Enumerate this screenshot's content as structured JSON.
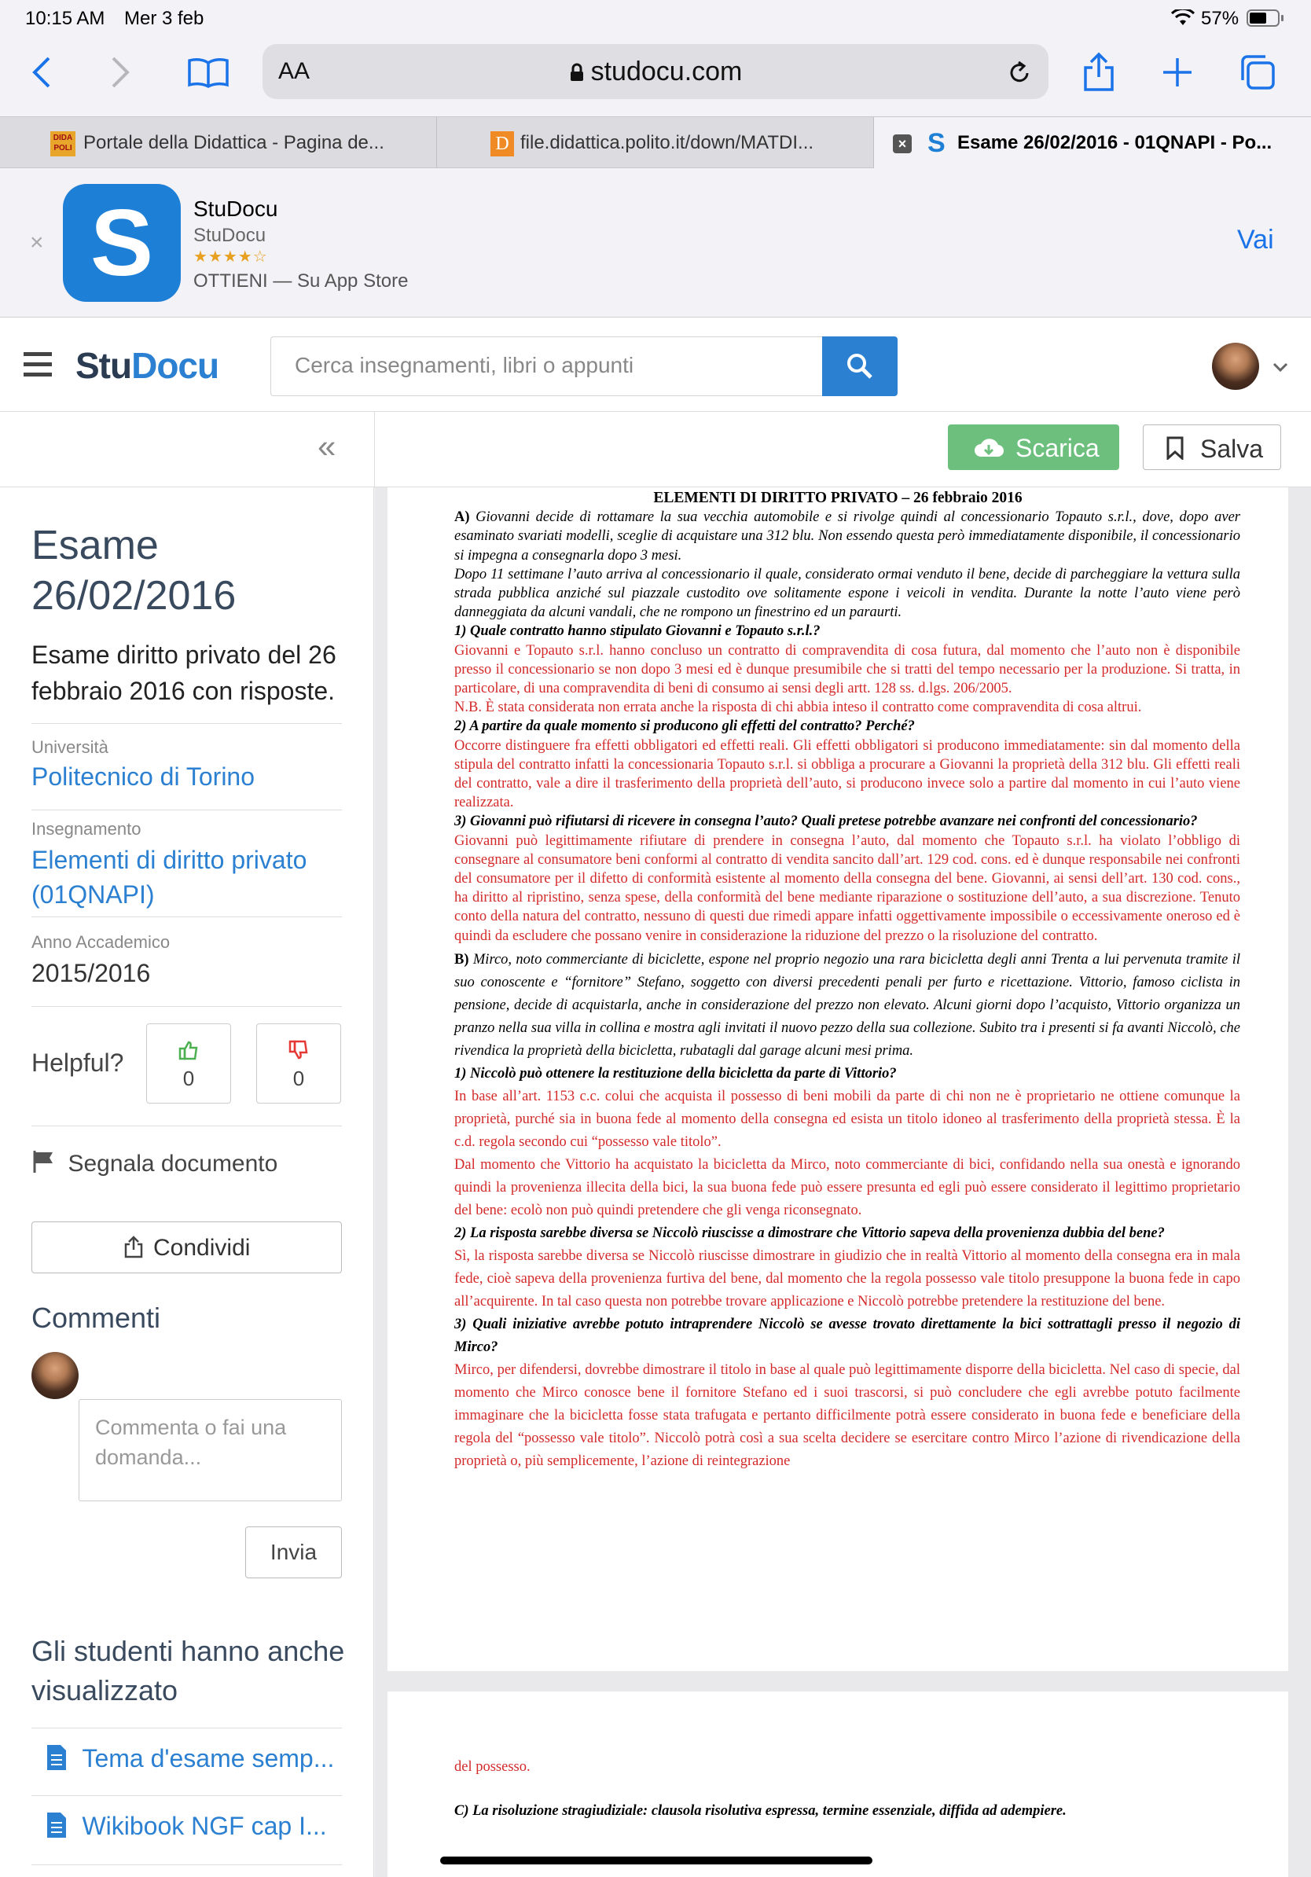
{
  "status_bar": {
    "time": "10:15 AM",
    "date": "Mer 3 feb",
    "battery": "57%"
  },
  "browser": {
    "aa_label": "AA",
    "url": "studocu.com",
    "tabs": [
      {
        "label": "Portale della Didattica - Pagina de..."
      },
      {
        "label": "file.didattica.polito.it/down/MATDI..."
      },
      {
        "label": "Esame 26/02/2016 - 01QNAPI - Po..."
      }
    ]
  },
  "app_banner": {
    "icon_letter": "S",
    "name": "StuDocu",
    "developer": "StuDocu",
    "stars": "★★★★☆",
    "cta": "OTTIENI — Su App Store",
    "open_label": "Vai"
  },
  "site": {
    "logo_stu": "Stu",
    "logo_docu": "Docu",
    "search_placeholder": "Cerca insegnamenti, libri o appunti",
    "download_label": "Scarica",
    "save_label": "Salva",
    "collapse_glyph": "«"
  },
  "sidebar": {
    "title_line1": "Esame",
    "title_line2": "26/02/2016",
    "description": "Esame diritto privato del 26 febbraio 2016 con risposte.",
    "university_label": "Università",
    "university": "Politecnico di Torino",
    "course_label": "Insegnamento",
    "course": "Elementi di diritto privato (01QNAPI)",
    "year_label": "Anno Accademico",
    "year": "2015/2016",
    "helpful_label": "Helpful?",
    "upvotes": "0",
    "downvotes": "0",
    "report_label": "Segnala documento",
    "share_label": "Condividi",
    "comments_title": "Commenti",
    "comment_placeholder": "Commenta o fai una domanda...",
    "send_label": "Invia",
    "related_title": "Gli studenti hanno anche visualizzato",
    "related": [
      {
        "label": "Tema d'esame semp..."
      },
      {
        "label": "Wikibook NGF cap I..."
      }
    ]
  },
  "document": {
    "title": "ELEMENTI DI DIRITTO PRIVATO – 26 febbraio 2016",
    "a_label": "A)",
    "a_text": "Giovanni decide di rottamare la sua vecchia automobile e si rivolge quindi al concessionario Topauto s.r.l., dove, dopo aver esaminato svariati modelli, sceglie di acquistare una 312 blu. Non essendo questa però immediatamente disponibile, il concessionario si impegna a consegnarla dopo 3 mesi.",
    "a_text2": "Dopo 11 settimane l’auto arriva al concessionario il quale, considerato ormai venduto il bene, decide di parcheggiare la vettura sulla strada pubblica anziché sul piazzale custodito ove solitamente espone i veicoli in vendita. Durante la notte l’auto viene però danneggiata da alcuni vandali, che ne rompono un finestrino ed un paraurti.",
    "q1": "1) Quale contratto hanno stipulato Giovanni e Topauto s.r.l.?",
    "a1": "Giovanni e Topauto s.r.l. hanno concluso un contratto di compravendita di cosa futura, dal momento che l’auto non è disponibile presso il concessionario se non dopo 3 mesi ed è dunque presumibile che si tratti del tempo necessario per la produzione. Si tratta, in particolare, di una compravendita di beni di consumo ai sensi degli artt. 128 ss. d.lgs. 206/2005.",
    "a1_nb": "N.B. È stata considerata non errata anche la risposta di chi abbia inteso il contratto come compravendita di cosa altrui.",
    "q2": "2) A partire da quale momento si producono gli effetti del contratto? Perché?",
    "a2": "Occorre distinguere fra effetti obbligatori ed effetti reali. Gli effetti obbligatori si producono immediatamente: sin dal momento della stipula del contratto infatti la concessionaria Topauto s.r.l. si obbliga a procurare a Giovanni la proprietà della 312 blu. Gli effetti reali del contratto, vale a dire il trasferimento della proprietà dell’auto, si producono invece solo a partire dal momento in cui l’auto viene realizzata.",
    "q3": "3) Giovanni può rifiutarsi di ricevere in consegna l’auto? Quali pretese potrebbe avanzare nei confronti del concessionario?",
    "a3": "Giovanni può legittimamente rifiutare di prendere in consegna l’auto, dal momento che Topauto s.r.l. ha violato l’obbligo di consegnare al consumatore beni conformi al contratto di vendita sancito dall’art. 129 cod. cons. ed è dunque responsabile nei confronti del consumatore per il difetto di conformità esistente al momento della consegna del bene. Giovanni, ai sensi dell’art. 130 cod. cons., ha diritto al ripristino, senza spese, della conformità del bene mediante riparazione o sostituzione dell’auto, a sua discrezione. Tenuto conto della natura del contratto, nessuno di questi due rimedi appare infatti oggettivamente impossibile o eccessivamente oneroso ed è quindi da escludere che possano venire in considerazione la riduzione del prezzo o la risoluzione del contratto.",
    "b_label": "B)",
    "b_text": "Mirco, noto commerciante di biciclette, espone nel proprio negozio una rara bicicletta degli anni Trenta a lui pervenuta tramite il suo conoscente e “fornitore” Stefano, soggetto con diversi precedenti penali per furto e ricettazione. Vittorio, famoso ciclista in pensione, decide di acquistarla, anche in considerazione del prezzo non elevato. Alcuni giorni dopo l’acquisto, Vittorio organizza un pranzo nella sua villa in collina e mostra agli invitati il nuovo pezzo della sua collezione. Subito tra i presenti si fa avanti Niccolò, che rivendica la proprietà della bicicletta, rubatagli dal garage alcuni mesi prima.",
    "bq1": "1) Niccolò può ottenere la restituzione della bicicletta da parte di Vittorio?",
    "ba1": "In base all’art. 1153 c.c. colui che acquista il possesso di beni mobili da parte di chi non ne è proprietario ne ottiene comunque la proprietà, purché sia in buona fede al momento della consegna ed esista un titolo idoneo al trasferimento della proprietà stessa. È la c.d. regola  secondo cui “possesso vale titolo”.",
    "ba1b": "Dal momento che Vittorio ha acquistato la bicicletta da Mirco, noto commerciante di bici, confidando nella sua onestà e ignorando quindi la provenienza illecita della bici, la sua buona fede può essere presunta ed egli può essere considerato il legittimo proprietario del bene: ecolò non può quindi pretendere che gli venga riconsegnato.",
    "bq2": " 2) La risposta sarebbe diversa se Niccolò riuscisse a dimostrare che Vittorio sapeva della provenienza dubbia del bene?",
    "ba2": "Sì, la risposta sarebbe diversa se Niccolò riuscisse dimostrare in giudizio che in realtà Vittorio al momento della consegna era in mala fede, cioè sapeva della provenienza furtiva del bene, dal momento che la regola possesso vale titolo presuppone la buona fede in capo all’acquirente. In tal caso questa non potrebbe trovare applicazione e Niccolò potrebbe pretendere la restituzione del bene.",
    "bq3": "3) Quali iniziative avrebbe potuto intraprendere Niccolò se avesse trovato direttamente la bici sottrattagli presso il negozio di Mirco?",
    "ba3": "Mirco, per difendersi, dovrebbe dimostrare il titolo in base al quale può legittimamente disporre della bicicletta. Nel caso di specie, dal momento che Mirco conosce bene il fornitore Stefano ed i suoi trascorsi, si può concludere che egli avrebbe potuto facilmente immaginare che la bicicletta fosse stata trafugata e pertanto difficilmente potrà essere considerato in buona fede e beneficiare della regola del “possesso vale titolo”. Niccolò potrà così a sua scelta decidere se esercitare contro Mirco l’azione di rivendicazione della proprietà o, più semplicemente, l’azione di reintegrazione",
    "p2_cont": "del possesso.",
    "c_text": "C) La risoluzione stragiudiziale: clausola risolutiva espressa, termine essenziale, diffida ad adempiere."
  }
}
